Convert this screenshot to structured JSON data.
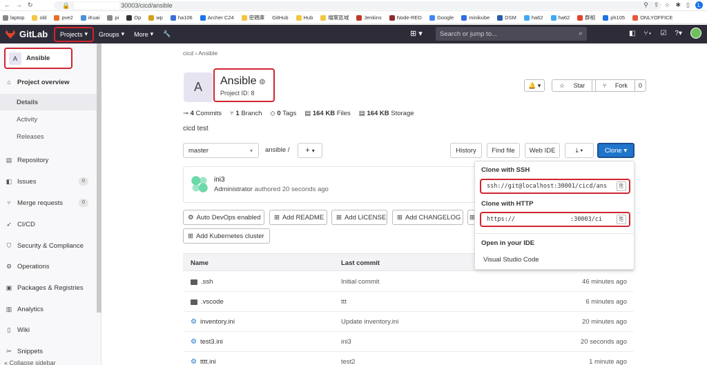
{
  "browser": {
    "url": "30003/cicd/ansible",
    "bookmarks": [
      "laptop",
      "old",
      "pve2",
      "iKuai",
      "pi",
      "Op",
      "wp",
      "ha106",
      "Archer C24",
      "密碼庫",
      "GitHub",
      "Hub",
      "檔案區域",
      "Jenkins",
      "Node-RED",
      "Google",
      "minikube",
      "DSM",
      "ha62",
      "ha62",
      "群組",
      "ph105",
      "ONLYOFFICE"
    ],
    "profile_initial": "L"
  },
  "topnav": {
    "brand": "GitLab",
    "projects": "Projects",
    "groups": "Groups",
    "more": "More",
    "search_placeholder": "Search or jump to..."
  },
  "sidebar": {
    "project_initial": "A",
    "project_name": "Ansible",
    "items": [
      {
        "label": "Project overview"
      },
      {
        "label": "Details"
      },
      {
        "label": "Activity"
      },
      {
        "label": "Releases"
      },
      {
        "label": "Repository"
      },
      {
        "label": "Issues",
        "count": "0"
      },
      {
        "label": "Merge requests",
        "count": "0"
      },
      {
        "label": "CI/CD"
      },
      {
        "label": "Security & Compliance"
      },
      {
        "label": "Operations"
      },
      {
        "label": "Packages & Registries"
      },
      {
        "label": "Analytics"
      },
      {
        "label": "Wiki"
      },
      {
        "label": "Snippets"
      }
    ],
    "collapse": "Collapse sidebar"
  },
  "breadcrumb": {
    "group": "cicd",
    "project": "Ansible"
  },
  "project": {
    "initial": "A",
    "name": "Ansible",
    "id_label": "Project ID: 8",
    "description": "cicd test",
    "star_label": "Star",
    "star_count": "0",
    "fork_label": "Fork",
    "fork_count": "0"
  },
  "stats": {
    "commits": "4",
    "commits_label": "Commits",
    "branches": "1",
    "branches_label": "Branch",
    "tags": "0",
    "tags_label": "Tags",
    "files": "164 KB",
    "files_label": "Files",
    "storage": "164 KB",
    "storage_label": "Storage"
  },
  "toolbar": {
    "branch": "master",
    "path": "ansible",
    "history": "History",
    "find_file": "Find file",
    "web_ide": "Web IDE",
    "clone": "Clone"
  },
  "last_commit": {
    "message": "ini3",
    "author": "Administrator",
    "authored": "authored 20 seconds ago"
  },
  "actions": [
    "Auto DevOps enabled",
    "Add README",
    "Add LICENSE",
    "Add CHANGELOG",
    "Add Kubernetes cluster"
  ],
  "table": {
    "headers": {
      "name": "Name",
      "last_commit": "Last commit"
    },
    "rows": [
      {
        "name": ".ssh",
        "type": "folder",
        "commit": "Initial commit",
        "updated": "46 minutes ago"
      },
      {
        "name": ".vscode",
        "type": "folder",
        "commit": "ttt",
        "updated": "6 minutes ago"
      },
      {
        "name": "inventory.ini",
        "type": "file",
        "commit": "Update inventory.ini",
        "updated": "20 minutes ago"
      },
      {
        "name": "test3.ini",
        "type": "file",
        "commit": "ini3",
        "updated": "20 seconds ago"
      },
      {
        "name": "tttt.ini",
        "type": "file",
        "commit": "test2",
        "updated": "1 minute ago"
      }
    ]
  },
  "clone_dropdown": {
    "ssh_title": "Clone with SSH",
    "ssh_url": "ssh://git@localhost:30001/cicd/ans",
    "http_title": "Clone with HTTP",
    "http_url_start": "https://",
    "http_url_end": ":30003/ci",
    "ide_title": "Open in your IDE",
    "ide_option": "Visual Studio Code"
  },
  "colors": {
    "accent": "#1f75cb",
    "highlight": "#d1242f",
    "nav_bg": "#2e2c38"
  }
}
